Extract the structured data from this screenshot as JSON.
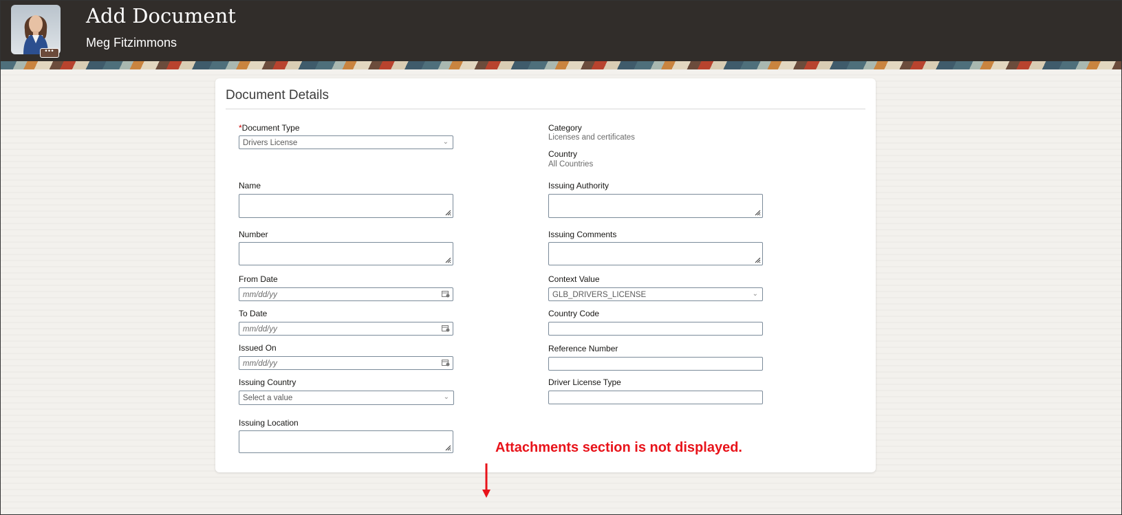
{
  "header": {
    "title": "Add Document",
    "user_name": "Meg Fitzimmons",
    "avatar_badge": "•••"
  },
  "card": {
    "title": "Document Details",
    "required_mark": "*",
    "left": {
      "document_type": {
        "label": "Document Type",
        "value": "Drivers License"
      },
      "name": {
        "label": "Name"
      },
      "number": {
        "label": "Number"
      },
      "from_date": {
        "label": "From Date",
        "placeholder": "mm/dd/yy"
      },
      "to_date": {
        "label": "To Date",
        "placeholder": "mm/dd/yy"
      },
      "issued_on": {
        "label": "Issued On",
        "placeholder": "mm/dd/yy"
      },
      "issuing_country": {
        "label": "Issuing Country",
        "placeholder": "Select a value"
      },
      "issuing_location": {
        "label": "Issuing Location"
      }
    },
    "right": {
      "category": {
        "label": "Category",
        "value": "Licenses and certificates"
      },
      "country": {
        "label": "Country",
        "value": "All Countries"
      },
      "issuing_authority": {
        "label": "Issuing Authority"
      },
      "issuing_comments": {
        "label": "Issuing Comments"
      },
      "context_value": {
        "label": "Context Value",
        "value": "GLB_DRIVERS_LICENSE"
      },
      "country_code": {
        "label": "Country Code"
      },
      "reference_number": {
        "label": "Reference Number"
      },
      "driver_license_type": {
        "label": "Driver License Type"
      }
    }
  },
  "annotation": {
    "text": "Attachments section is not displayed.",
    "color": "#e8131a"
  },
  "icons": {
    "dropdown": "chevron-down-icon",
    "date": "calendar-icon",
    "resize": "resize-handle-icon"
  },
  "colors": {
    "header_bg": "#312d2a",
    "field_border": "#7a8a99"
  }
}
